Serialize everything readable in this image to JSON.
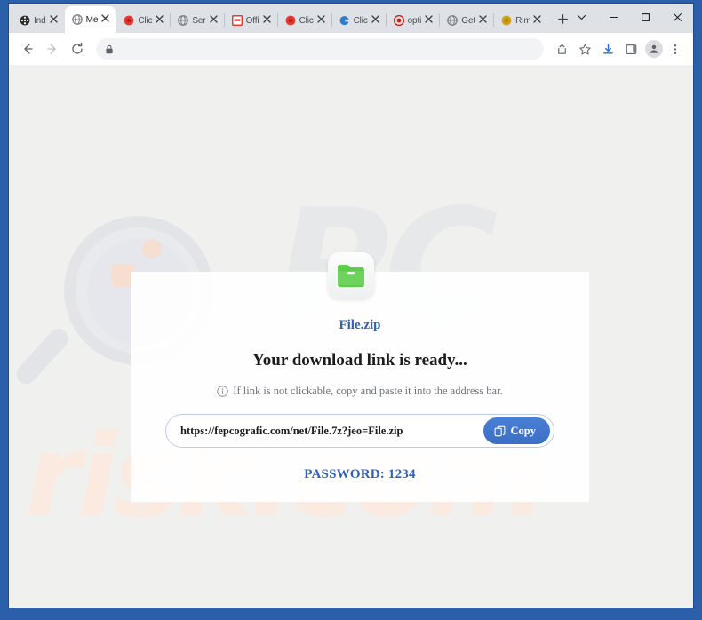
{
  "window": {
    "controls": [
      {
        "name": "tab-search-button",
        "glyph": "chevron-down"
      },
      {
        "name": "minimize-button",
        "glyph": "minimize"
      },
      {
        "name": "maximize-button",
        "glyph": "maximize"
      },
      {
        "name": "close-button",
        "glyph": "close"
      }
    ]
  },
  "tabs": [
    {
      "label": "Ind",
      "favicon": "film-reel-icon",
      "color": "#2b2b2b",
      "active": false
    },
    {
      "label": "Me",
      "favicon": "globe-icon",
      "color": "#7b7f83",
      "active": true
    },
    {
      "label": "Clic",
      "favicon": "red-circle-icon",
      "color": "#e8392f",
      "active": false
    },
    {
      "label": "Ser",
      "favicon": "globe-icon",
      "color": "#7b7f83",
      "active": false
    },
    {
      "label": "Offi",
      "favicon": "red-square-icon",
      "color": "#e8392f",
      "active": false
    },
    {
      "label": "Clic",
      "favicon": "red-circle-icon",
      "color": "#e8392f",
      "active": false
    },
    {
      "label": "Clic",
      "favicon": "blue-swirl-icon",
      "color": "#2a7fd4",
      "active": false
    },
    {
      "label": "opti",
      "favicon": "red-target-icon",
      "color": "#c4241c",
      "active": false
    },
    {
      "label": "Get",
      "favicon": "globe-icon",
      "color": "#7b7f83",
      "active": false
    },
    {
      "label": "Rim",
      "favicon": "orange-circle-icon",
      "color": "#d4a017",
      "active": false
    }
  ],
  "newtab": {
    "label": "+",
    "name": "new-tab-button"
  },
  "toolbar": {
    "back": "back-arrow-icon",
    "forward": "forward-arrow-icon",
    "reload": "reload-icon",
    "omnibox": {
      "value": "",
      "placeholder": "",
      "lock": "lock-icon"
    },
    "right_icons": [
      {
        "name": "share-icon"
      },
      {
        "name": "bookmark-star-icon"
      },
      {
        "name": "download-icon"
      },
      {
        "name": "side-panel-icon"
      },
      {
        "name": "profile-avatar-icon"
      },
      {
        "name": "three-dot-menu-icon"
      }
    ]
  },
  "page": {
    "watermark": {
      "logo": "magnifier-icon",
      "brand_grey": "PC",
      "brand_orange": "risk.com"
    },
    "card": {
      "file_icon": "zip-folder-icon",
      "filename": "File.zip",
      "headline": "Your download link is ready...",
      "hint_icon": "info-circle-icon",
      "hint": "If link is not clickable, copy and paste it into the address bar.",
      "link": "https://fepcografic.com/net/File.7z?jeo=File.zip",
      "copy_label": "Copy",
      "copy_icon": "copy-icon",
      "password": "PASSWORD: 1234"
    }
  },
  "colors": {
    "frame_blue": "#2b5faa",
    "accent_blue": "#2f62b5",
    "button_blue": "#3a6fc6",
    "zip_green": "#5ecb4c",
    "watermark_grey": "#e7e8ea",
    "watermark_orange": "#faeadf"
  }
}
